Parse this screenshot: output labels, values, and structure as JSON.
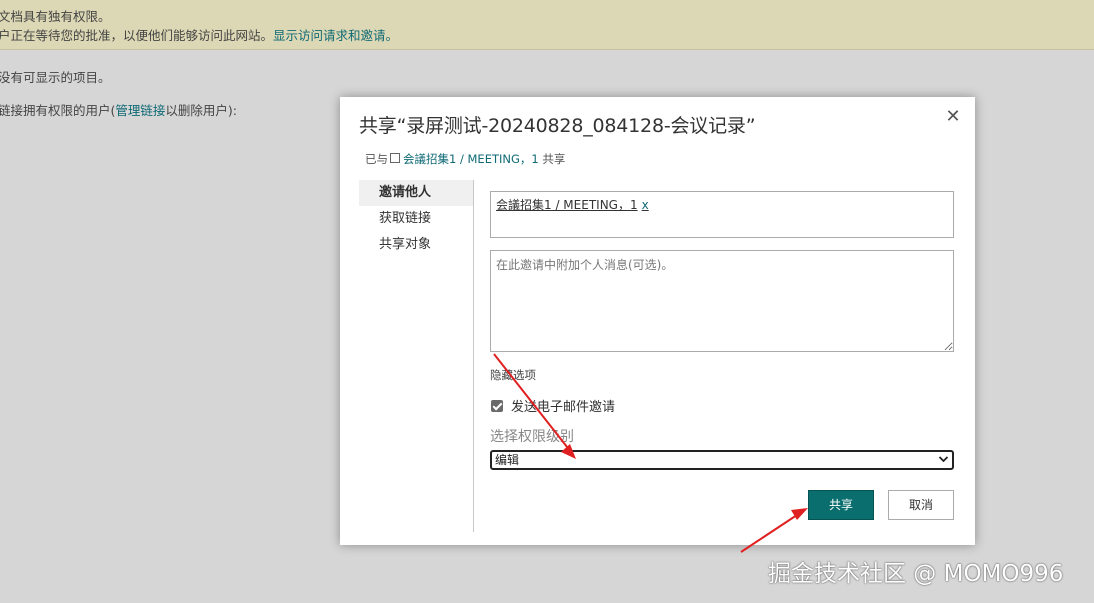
{
  "background": {
    "banner_line1": "文档具有独有权限。",
    "banner_line2_text": "户正在等待您的批准，以便他们能够访问此网站。",
    "banner_line2_link": "显示访问请求和邀请。",
    "no_items": "没有可显示的项目。",
    "link_users_prefix": "链接拥有权限的用户(",
    "link_users_link": "管理链接",
    "link_users_suffix": "以删除用户):"
  },
  "dialog": {
    "title": "共享“录屏测试-20240828_084128-会议记录”",
    "close_glyph": "✕",
    "shared_prefix": "已与",
    "shared_who": "会議招集1 / MEETING，1",
    "shared_suffix": "共享",
    "nav": [
      {
        "label": "邀请他人"
      },
      {
        "label": "获取链接"
      },
      {
        "label": "共享对象"
      }
    ],
    "recipient": {
      "name": "会議招集1 / MEETING，1",
      "remove_glyph": "x"
    },
    "message_placeholder": "在此邀请中附加个人消息(可选)。",
    "hide_options": "隐藏选项",
    "send_email_label": "发送电子邮件邀请",
    "send_email_checked": true,
    "permission_label": "选择权限级别",
    "permission_value": "编辑",
    "share_button": "共享",
    "cancel_button": "取消"
  },
  "watermark": "掘金技术社区 @ MOMO996",
  "colors": {
    "accent": "#0a6e6e",
    "link": "#0f6a75",
    "arrow": "#e02020",
    "banner": "#dcd7b4"
  }
}
